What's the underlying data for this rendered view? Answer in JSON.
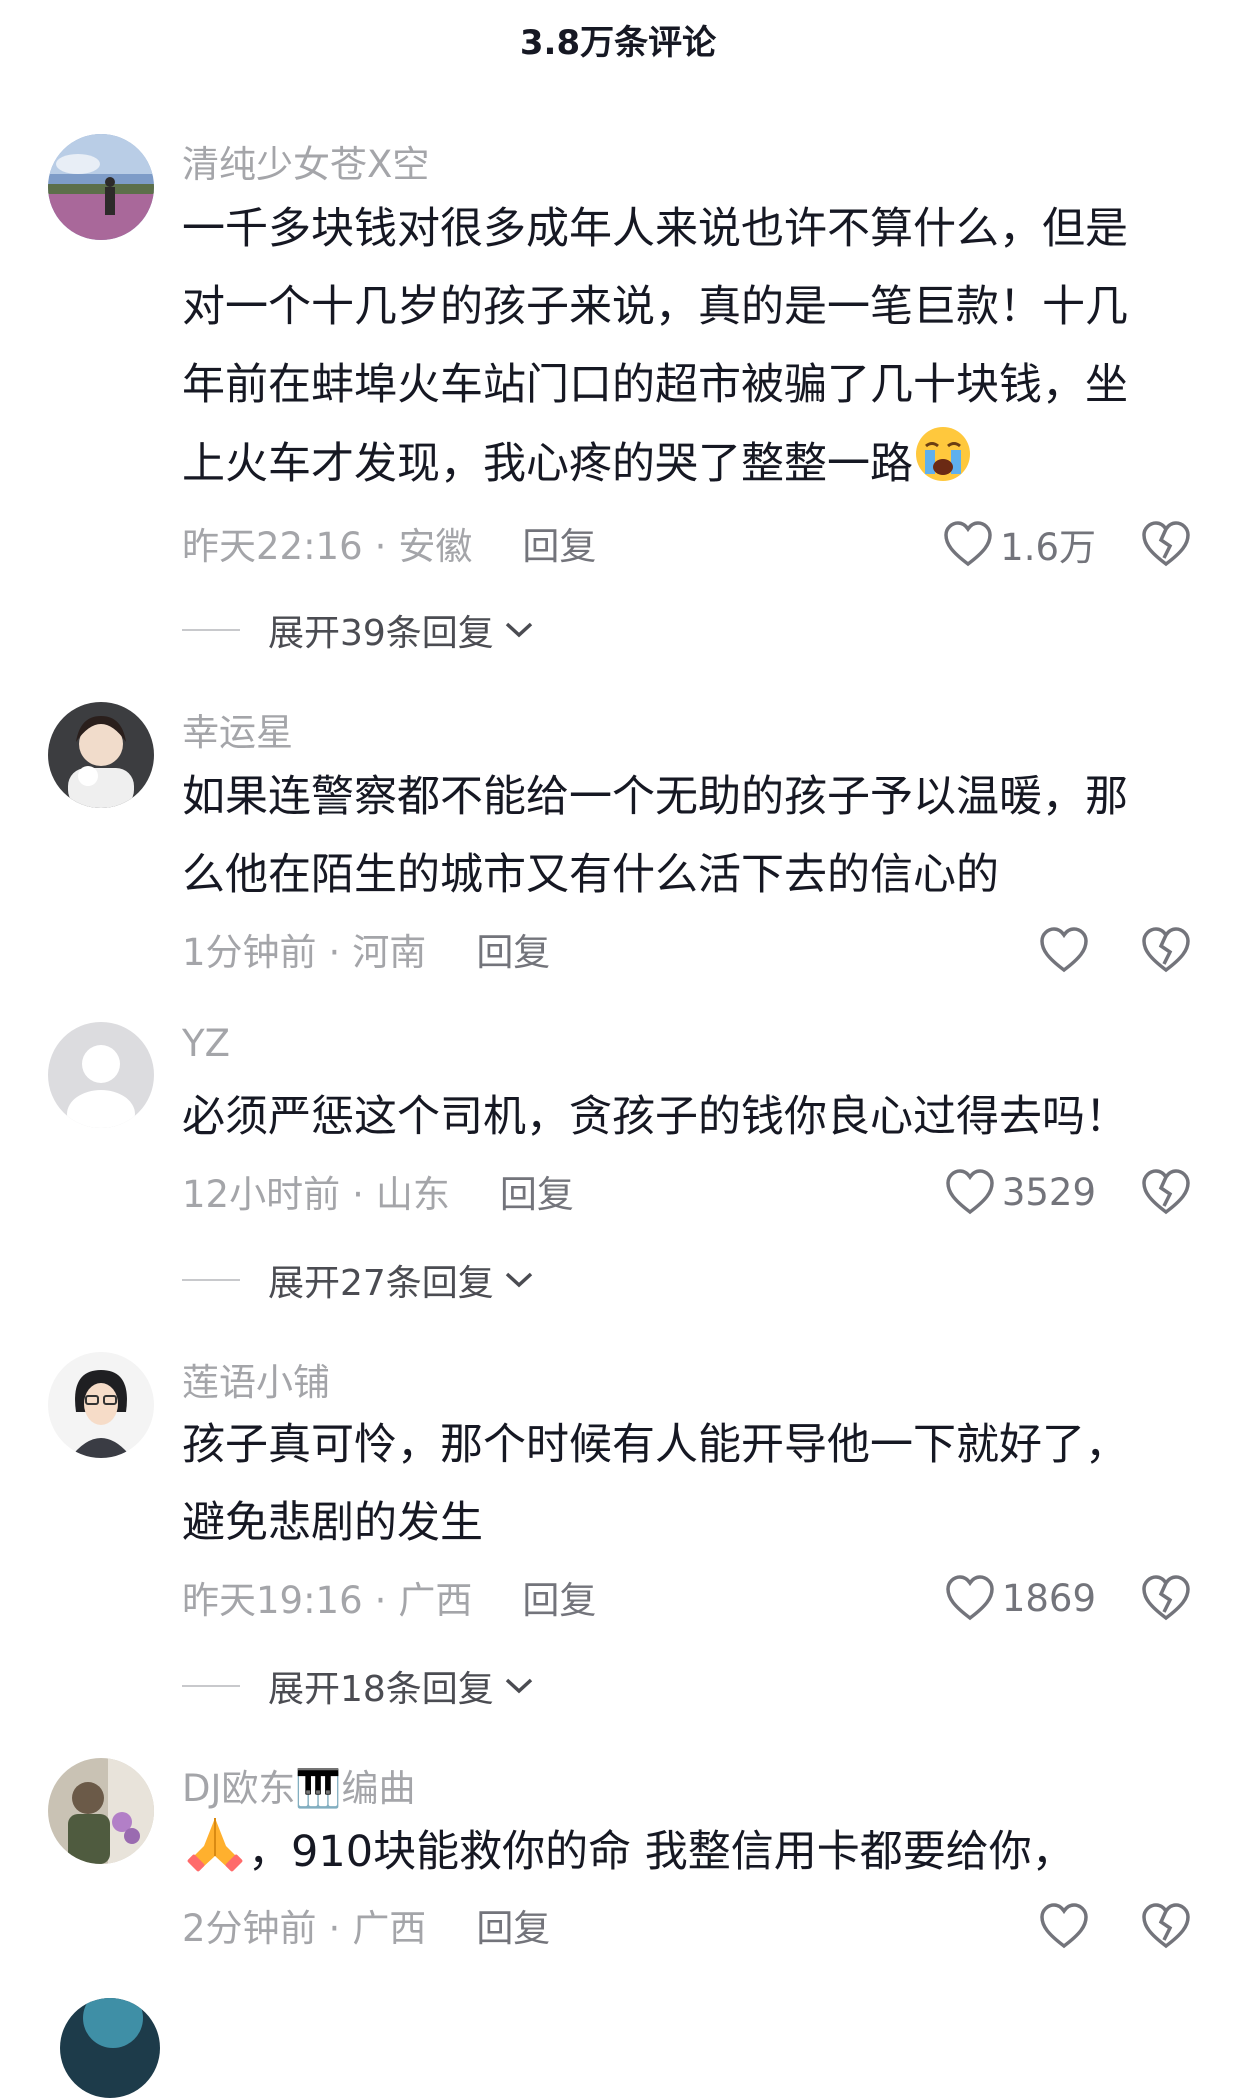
{
  "header": {
    "title": "3.8万条评论"
  },
  "comments": [
    {
      "username": "清纯少女苍X空",
      "lines": [
        "一千多块钱对很多成年人来说也许不算什么，但是",
        "对一个十几岁的孩子来说，真的是一笔巨款！十几",
        "年前在蚌埠火车站门口的超市被骗了几十块钱，坐",
        "上火车才发现，我心疼的哭了整整一路"
      ],
      "time": "昨天22:16",
      "dot": "·",
      "location": "安徽",
      "reply": "回复",
      "likes": "1.6万",
      "expand": "展开39条回复"
    },
    {
      "username": "幸运星",
      "lines": [
        "如果连警察都不能给一个无助的孩子予以温暖，那",
        "么他在陌生的城市又有什么活下去的信心的"
      ],
      "time": "1分钟前",
      "dot": "·",
      "location": "河南",
      "reply": "回复",
      "likes": ""
    },
    {
      "username": "YZ",
      "lines": [
        "必须严惩这个司机，贪孩子的钱你良心过得去吗！"
      ],
      "time": "12小时前",
      "dot": "·",
      "location": "山东",
      "reply": "回复",
      "likes": "3529",
      "expand": "展开27条回复"
    },
    {
      "username": "莲语小铺",
      "lines": [
        "孩子真可怜，那个时候有人能开导他一下就好了，",
        "避免悲剧的发生"
      ],
      "time": "昨天19:16",
      "dot": "·",
      "location": "广西",
      "reply": "回复",
      "likes": "1869",
      "expand": "展开18条回复"
    },
    {
      "username": "DJ欧东🎹编曲",
      "lines": [
        "，910块能救你的命 我整信用卡都要给你，"
      ],
      "time": "2分钟前",
      "dot": "·",
      "location": "广西",
      "reply": "回复",
      "likes": ""
    }
  ],
  "icons": {
    "like": "heart-outline-icon",
    "dislike": "broken-heart-icon",
    "expand": "chevron-down-icon",
    "emoji_crying": "loudly-crying-face-icon",
    "emoji_pray": "folded-hands-icon"
  },
  "colors": {
    "text": "#161823",
    "secondary": "#a4a5a9",
    "background": "#ffffff"
  }
}
